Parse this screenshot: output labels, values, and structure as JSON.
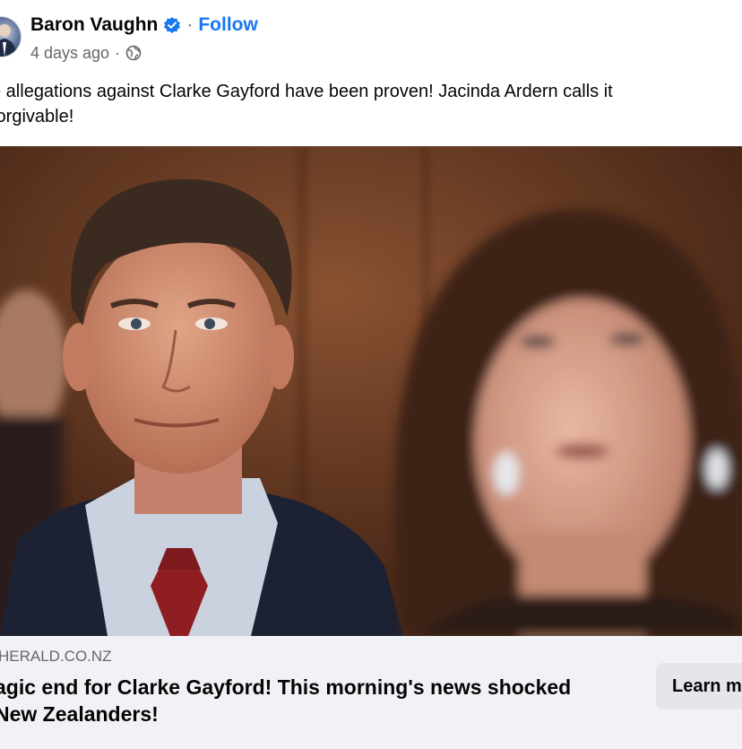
{
  "post": {
    "author": "Baron Vaughn",
    "follow_label": "Follow",
    "separator": "·",
    "timestamp": "4 days ago",
    "meta_separator": "·",
    "text_line1": "e allegations against Clarke Gayford have been proven! Jacinda Ardern calls it",
    "text_line2": "forgivable!"
  },
  "link_card": {
    "domain": "HERALD.CO.NZ",
    "title_line1": "agic end for Clarke Gayford! This morning's news shocked",
    "title_line2": " New Zealanders!",
    "cta_label": "Learn m"
  },
  "icons": {
    "verified": "verified-badge-icon",
    "audience": "globe-icon"
  },
  "colors": {
    "accent": "#1877f2",
    "secondary_text": "#65676b",
    "card_bg": "#f0f2f5",
    "button_bg": "#e4e6eb"
  }
}
